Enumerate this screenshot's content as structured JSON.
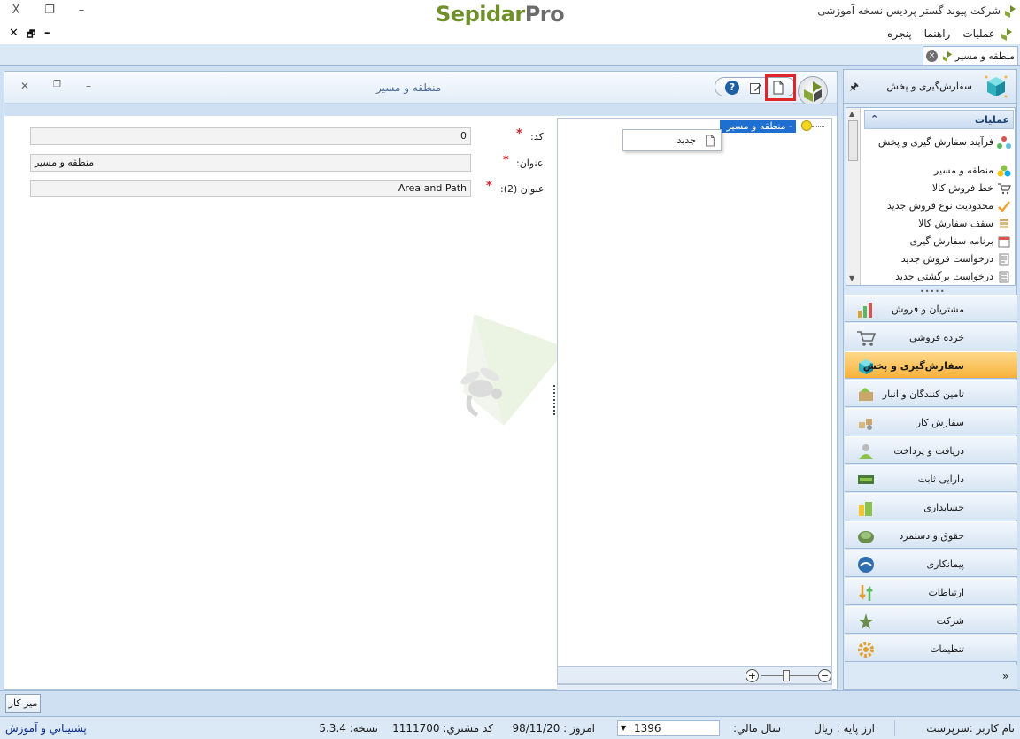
{
  "window": {
    "title": "شرکت پیوند گستر پردیس نسخه آموزشی",
    "brand_part1": "Sepidar",
    "brand_part2": "Pro",
    "close_glyph": "X",
    "restore_glyph": "❐",
    "minimize_glyph": "–"
  },
  "menu": {
    "items": [
      "عملیات",
      "راهنما",
      "پنجره"
    ],
    "mdi_close": "✕",
    "mdi_restore": "🗗",
    "mdi_minimize": "–"
  },
  "document_tab": {
    "label": "منطقه و مسیر",
    "close_glyph": "×"
  },
  "form": {
    "title": "منطقه و مسیر",
    "toolbar": {
      "new_icon": "new-document-icon",
      "edit_icon": "edit-icon",
      "help_label": "?"
    },
    "fields": [
      {
        "label": "کد:",
        "value": "0"
      },
      {
        "label": "عنوان:",
        "value": "منطقه و مسیر"
      },
      {
        "label": "عنوان (2):",
        "value": "Area and Path"
      }
    ],
    "required_mark": "*"
  },
  "tree": {
    "root_label": "-  منطقه و مسیر",
    "context_menu": [
      {
        "label": "جدید",
        "icon": "new-document-icon"
      }
    ],
    "zoom_in": "+",
    "zoom_out": "−"
  },
  "navigator": {
    "header_title": "سفارش‌گیری و پخش",
    "pin_glyph": "🖈",
    "operations_title": "عملیات",
    "collapse_glyph": "⌃",
    "operations": [
      {
        "label": "فرآیند سفارش گیری و پخش",
        "icon": "process-icon"
      },
      {
        "label": "منطقه و مسیر",
        "icon": "area-path-icon"
      },
      {
        "label": "خط فروش کالا",
        "icon": "cart-icon"
      },
      {
        "label": "محدودیت نوع فروش جدید",
        "icon": "limit-icon"
      },
      {
        "label": "سقف سفارش کالا",
        "icon": "ceiling-icon"
      },
      {
        "label": "برنامه سفارش گیری",
        "icon": "calendar-icon"
      },
      {
        "label": "درخواست فروش جدید",
        "icon": "sales-request-icon"
      },
      {
        "label": "درخواست برگشتی جدید",
        "icon": "return-request-icon"
      }
    ],
    "grip_glyph": "•••••",
    "modules": [
      {
        "label": "مشتریان و فروش",
        "icon": "chart-icon",
        "active": false
      },
      {
        "label": "خرده فروشی",
        "icon": "cart-icon",
        "active": false
      },
      {
        "label": "سفارش‌گیری و پخش",
        "icon": "cube-icon",
        "active": true
      },
      {
        "label": "تامین کنندگان و انبار",
        "icon": "warehouse-icon",
        "active": false
      },
      {
        "label": "سفارش کار",
        "icon": "work-order-icon",
        "active": false
      },
      {
        "label": "دریافت و پرداخت",
        "icon": "payment-icon",
        "active": false
      },
      {
        "label": "دارایی ثابت",
        "icon": "asset-icon",
        "active": false
      },
      {
        "label": "حسابداری",
        "icon": "accounting-icon",
        "active": false
      },
      {
        "label": "حقوق و دستمزد",
        "icon": "payroll-icon",
        "active": false
      },
      {
        "label": "پیمانکاری",
        "icon": "contracting-icon",
        "active": false
      },
      {
        "label": "ارتباطات",
        "icon": "communication-icon",
        "active": false
      },
      {
        "label": "شرکت",
        "icon": "company-icon",
        "active": false
      },
      {
        "label": "تنظیمات",
        "icon": "settings-icon",
        "active": false
      }
    ],
    "footer_glyph": "»"
  },
  "desktop_button": "میز کار",
  "status": {
    "username": "نام کاربر :سرپرست",
    "base_currency": "ارز پایه :   ريال",
    "fiscal_year_label": "سال مالي:",
    "fiscal_year": "1396",
    "today": "امروز :    98/11/20",
    "customer_code": "کد مشتري:    1111700",
    "version": "نسخه:    5.3.4",
    "support": "پشتيباني و آموزش"
  },
  "colors": {
    "accent": "#1f6fd0",
    "active_module": "#f7b23b",
    "highlight": "#e0262b",
    "brand_green": "#6f8f2a"
  }
}
